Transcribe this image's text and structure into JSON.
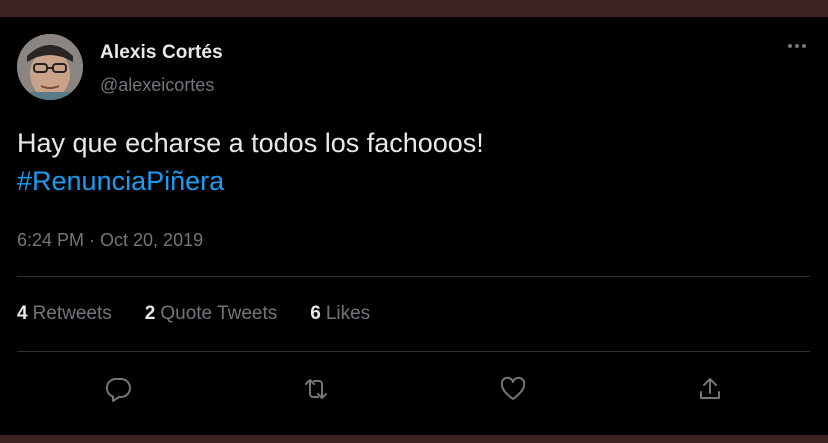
{
  "author": {
    "name": "Alexis Cortés",
    "handle": "@alexeicortes"
  },
  "tweet": {
    "text": "Hay que echarse a todos los fachooos!",
    "hashtag": "#RenunciaPiñera",
    "timestamp": "6:24 PM · Oct 20, 2019"
  },
  "stats": {
    "retweets_count": "4",
    "retweets_label": "Retweets",
    "quotes_count": "2",
    "quotes_label": "Quote Tweets",
    "likes_count": "6",
    "likes_label": "Likes"
  },
  "icons": {
    "reply": "reply-icon",
    "retweet": "retweet-icon",
    "like": "heart-icon",
    "share": "share-icon",
    "more": "more-icon"
  },
  "colors": {
    "background": "#000000",
    "text_primary": "#e7e9ea",
    "text_secondary": "#71767b",
    "link": "#1d9bf0",
    "divider": "#2f3336"
  }
}
